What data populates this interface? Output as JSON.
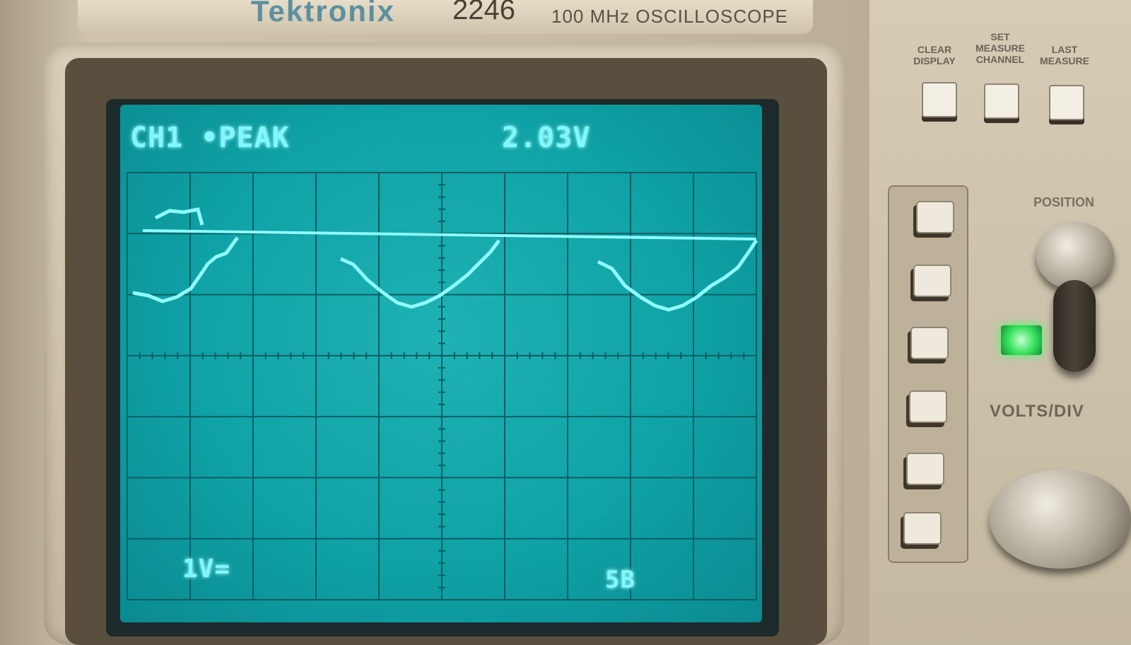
{
  "device": {
    "brand": "Tektronix",
    "model": "2246",
    "description": "100 MHz OSCILLOSCOPE"
  },
  "screen": {
    "channel_readout": "CH1 •PEAK",
    "measurement": "2.03V",
    "volts_per_div": "1V=",
    "time_readout": "5B",
    "trace_color": "#8ffcff",
    "grid_color": "#0a5f64"
  },
  "panel": {
    "buttons_top": [
      "CLEAR DISPLAY",
      "SET MEASURE CHANNEL",
      "LAST MEASURE"
    ],
    "position_label": "POSITION",
    "volts_div_label": "VOLTS/DIV",
    "led_color": "#33e05a"
  }
}
